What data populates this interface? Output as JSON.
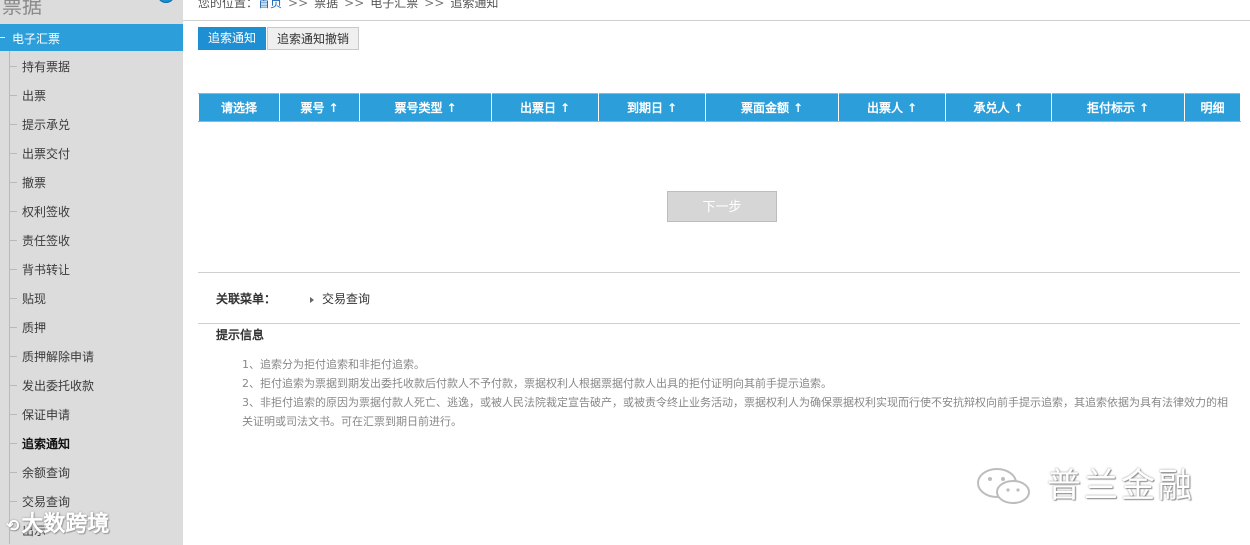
{
  "sidebar": {
    "title": "票据",
    "group_label": "电子汇票",
    "items": [
      {
        "label": "持有票据"
      },
      {
        "label": "出票"
      },
      {
        "label": "提示承兑"
      },
      {
        "label": "出票交付"
      },
      {
        "label": "撤票"
      },
      {
        "label": "权利签收"
      },
      {
        "label": "责任签收"
      },
      {
        "label": "背书转让"
      },
      {
        "label": "贴现"
      },
      {
        "label": "质押"
      },
      {
        "label": "质押解除申请"
      },
      {
        "label": "发出委托收款"
      },
      {
        "label": "保证申请"
      },
      {
        "label": "追索通知",
        "active": true
      },
      {
        "label": "余额查询"
      },
      {
        "label": "交易查询"
      },
      {
        "label": "出示"
      }
    ]
  },
  "breadcrumb": {
    "prefix": "您的位置：",
    "home": "首页",
    "sep": ">>",
    "items": [
      "票据",
      "电子汇票",
      "追索通知"
    ]
  },
  "tabs": [
    {
      "label": "追索通知",
      "active": true
    },
    {
      "label": "追索通知撤销",
      "active": false
    }
  ],
  "table": {
    "columns": [
      {
        "label": "请选择",
        "sortable": false
      },
      {
        "label": "票号",
        "sortable": true
      },
      {
        "label": "票号类型",
        "sortable": true
      },
      {
        "label": "出票日",
        "sortable": true
      },
      {
        "label": "到期日",
        "sortable": true
      },
      {
        "label": "票面金额",
        "sortable": true
      },
      {
        "label": "出票人",
        "sortable": true
      },
      {
        "label": "承兑人",
        "sortable": true
      },
      {
        "label": "拒付标示",
        "sortable": true
      },
      {
        "label": "明细",
        "sortable": false
      }
    ],
    "sort_arrow": "↑"
  },
  "next_button": "下一步",
  "related": {
    "label": "关联菜单：",
    "link": "交易查询"
  },
  "tips": {
    "title": "提示信息",
    "lines": [
      "1、追索分为拒付追索和非拒付追索。",
      "2、拒付追索为票据到期发出委托收款后付款人不予付款，票据权利人根据票据付款人出具的拒付证明向其前手提示追索。",
      "3、非拒付追索的原因为票据付款人死亡、逃逸，或被人民法院裁定宣告破产，或被责令终止业务活动，票据权利人为确保票据权利实现而行使不安抗辩权向前手提示追索，其追索依据为具有法律效力的相关证明或司法文书。可在汇票到期日前进行。"
    ]
  },
  "watermarks": {
    "left": "大数跨境",
    "right": "普兰金融"
  },
  "colors": {
    "accent": "#2c9fdb",
    "sidebar_bg": "#dcdcdc",
    "link": "#1a67b8"
  }
}
